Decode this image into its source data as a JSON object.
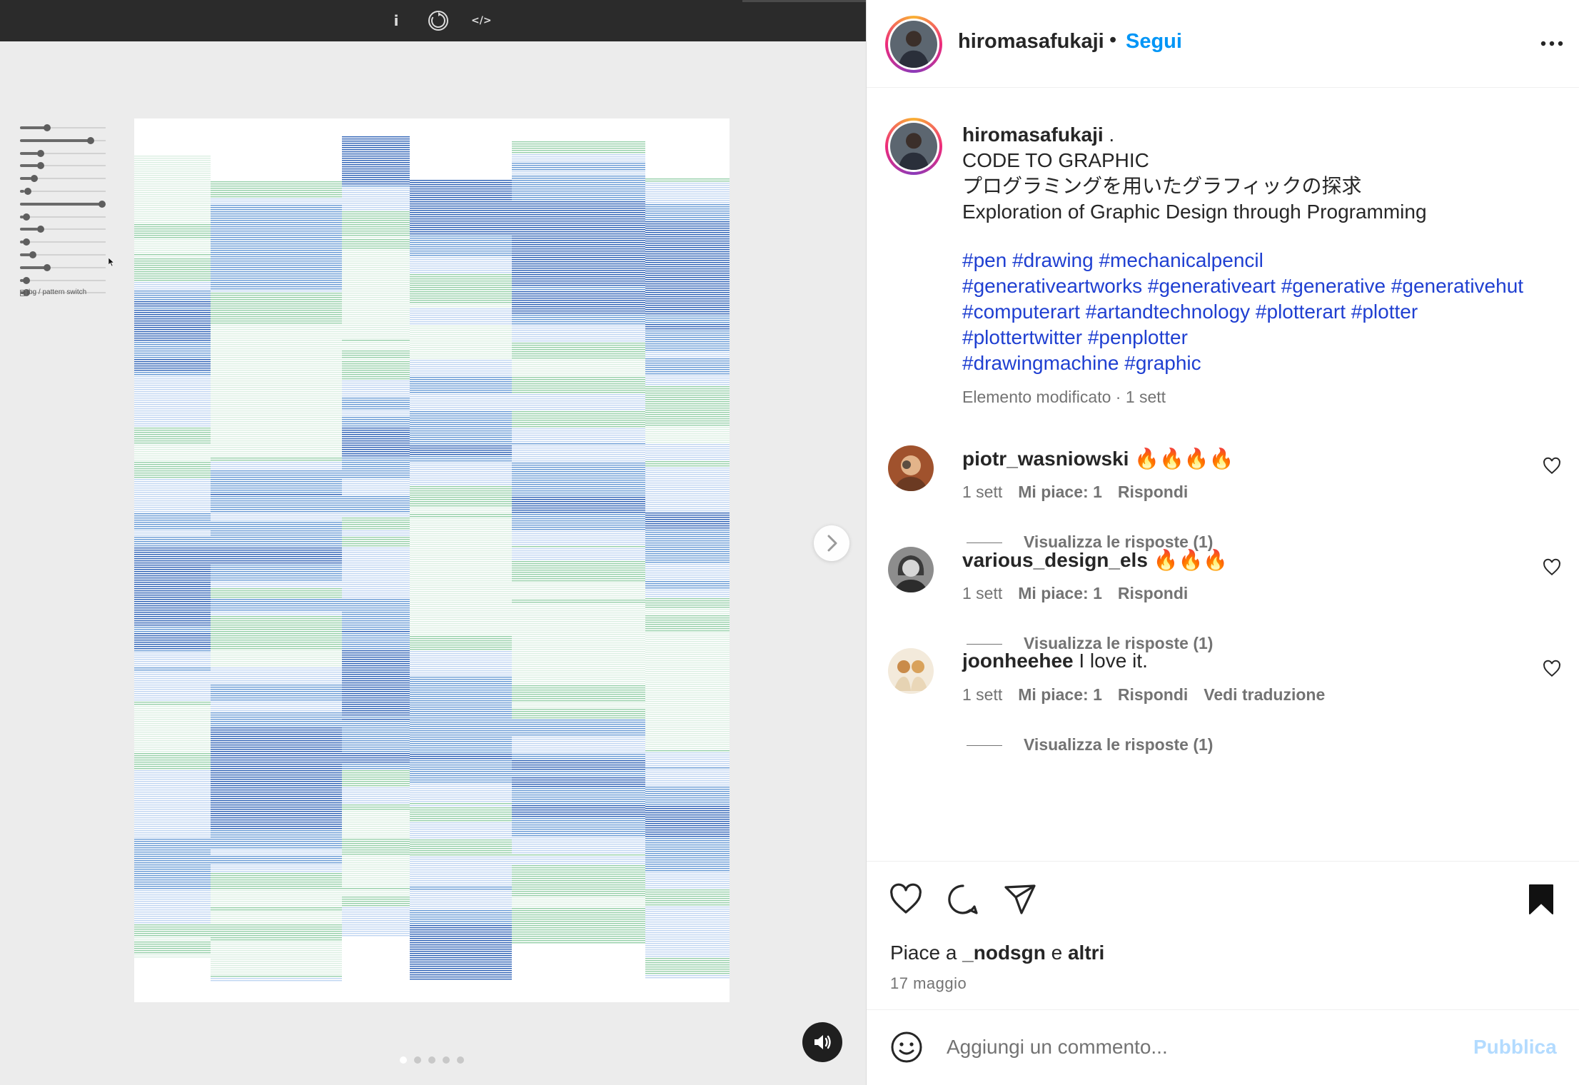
{
  "viewer": {
    "toolbar": {
      "info_icon": "info-icon",
      "reload_icon": "reload-icon",
      "code_icon": "code-icon",
      "info_glyph": "i",
      "code_glyph": "</>"
    },
    "pattern_switch_label": "bg / pattern switch",
    "sliders": [
      0.3,
      0.85,
      0.22,
      0.22,
      0.14,
      0.05,
      1.0,
      0.04,
      0.22,
      0.04,
      0.12,
      0.3,
      0.04,
      0.04
    ],
    "carousel": {
      "count": 5,
      "active": 0
    },
    "colors": {
      "deep_blue": "#1f56b0",
      "mid_blue": "#4a86cc",
      "light_blue": "#a9c7ec",
      "green": "#3aa55e",
      "background": "#ececec"
    }
  },
  "post": {
    "username": "hiromasafukaji",
    "separator": "•",
    "follow_label": "Segui",
    "caption": {
      "username": "hiromasafukaji",
      "username_suffix": " .",
      "lines": [
        "CODE TO GRAPHIC",
        "プログラミングを用いたグラフィックの探求",
        "Exploration of Graphic Design through Programming"
      ],
      "tag_lines": [
        "#pen #drawing #mechanicalpencil",
        "#generativeartworks #generativeart #generative #generativehut",
        "#computerart #artandtechnology #plotterart #plotter",
        "#plottertwitter #penplotter",
        "#drawingmachine #graphic"
      ],
      "meta": "Elemento modificato · 1 sett"
    },
    "comments": [
      {
        "username": "piotr_wasniowski",
        "text": " 🔥🔥🔥🔥",
        "time": "1 sett",
        "likes": "Mi piace: 1",
        "reply": "Rispondi",
        "translate": "",
        "view_replies": "Visualizza le risposte (1)"
      },
      {
        "username": "various_design_els",
        "text": " 🔥🔥🔥",
        "time": "1 sett",
        "likes": "Mi piace: 1",
        "reply": "Rispondi",
        "translate": "",
        "view_replies": "Visualizza le risposte (1)"
      },
      {
        "username": "joonheehee",
        "text": " I love it.",
        "time": "1 sett",
        "likes": "Mi piace: 1",
        "reply": "Rispondi",
        "translate": "Vedi traduzione",
        "view_replies": "Visualizza le risposte (1)"
      }
    ],
    "likes": {
      "prefix": "Piace a ",
      "user": "_nodsgn",
      "middle": " e ",
      "others": "altri"
    },
    "date": "17 maggio",
    "comment_placeholder": "Aggiungi un commento...",
    "publish_label": "Pubblica",
    "colors": {
      "link": "#0095f6",
      "hashtag": "#1f3fd1",
      "muted": "#737373",
      "text": "#262626",
      "publish_disabled": "#b3dbff"
    }
  }
}
